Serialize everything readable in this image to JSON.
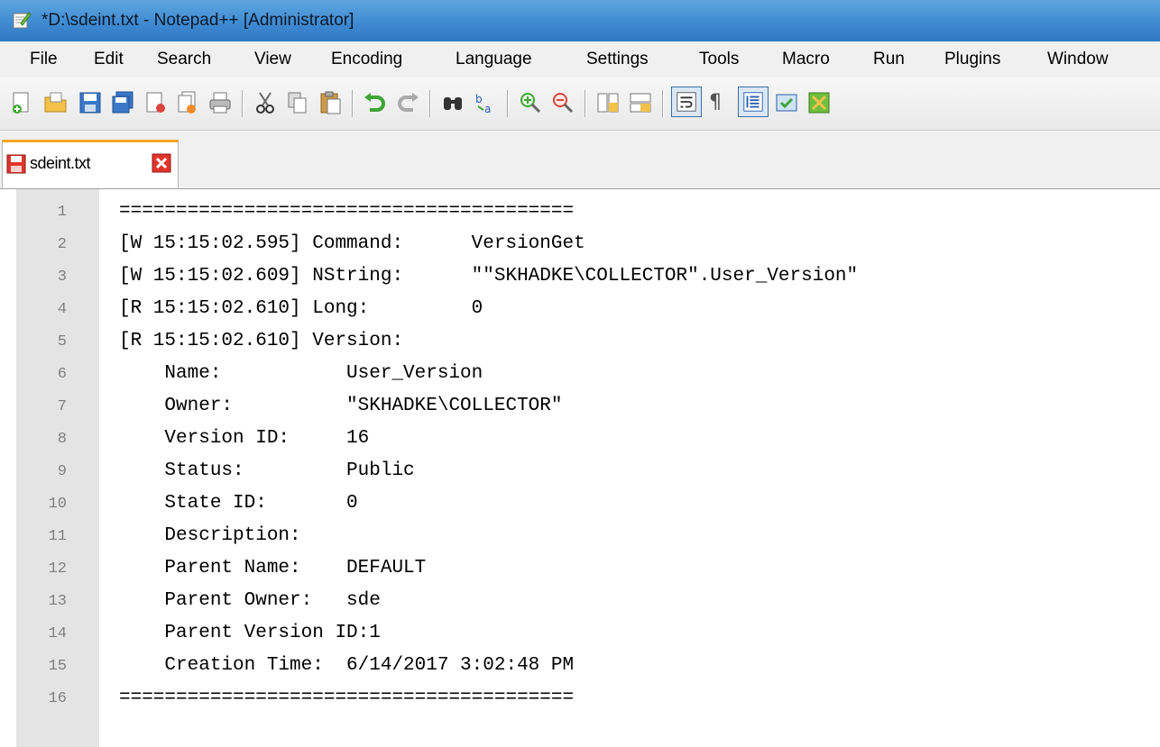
{
  "window": {
    "title": "*D:\\sdeint.txt - Notepad++ [Administrator]"
  },
  "menu": {
    "items": [
      {
        "label": "File"
      },
      {
        "label": "Edit"
      },
      {
        "label": "Search"
      },
      {
        "label": "View"
      },
      {
        "label": "Encoding"
      },
      {
        "label": "Language"
      },
      {
        "label": "Settings"
      },
      {
        "label": "Tools"
      },
      {
        "label": "Macro"
      },
      {
        "label": "Run"
      },
      {
        "label": "Plugins"
      },
      {
        "label": "Window"
      }
    ]
  },
  "toolbar": {
    "icons": [
      "new-file-icon",
      "open-file-icon",
      "save-icon",
      "save-all-icon",
      "close-icon",
      "close-all-icon",
      "print-icon",
      "cut-icon",
      "copy-icon",
      "paste-icon",
      "undo-icon",
      "redo-icon",
      "find-icon",
      "replace-icon",
      "zoom-in-icon",
      "zoom-out-icon",
      "sync-vertical-icon",
      "sync-horizontal-icon",
      "word-wrap-icon",
      "show-all-chars-icon",
      "indent-guide-icon",
      "user-language-icon",
      "doc-map-icon"
    ]
  },
  "tab": {
    "label": "sdeint.txt",
    "modified": true
  },
  "editor": {
    "lines": [
      {
        "num": "1",
        "text": "========================================"
      },
      {
        "num": "2",
        "text": "[W 15:15:02.595] Command:      VersionGet"
      },
      {
        "num": "3",
        "text": "[W 15:15:02.609] NString:      \"\"SKHADKE\\COLLECTOR\".User_Version\""
      },
      {
        "num": "4",
        "text": "[R 15:15:02.610] Long:         0"
      },
      {
        "num": "5",
        "text": "[R 15:15:02.610] Version:"
      },
      {
        "num": "6",
        "text": "    Name:           User_Version"
      },
      {
        "num": "7",
        "text": "    Owner:          \"SKHADKE\\COLLECTOR\""
      },
      {
        "num": "8",
        "text": "    Version ID:     16"
      },
      {
        "num": "9",
        "text": "    Status:         Public"
      },
      {
        "num": "10",
        "text": "    State ID:       0"
      },
      {
        "num": "11",
        "text": "    Description:"
      },
      {
        "num": "12",
        "text": "    Parent Name:    DEFAULT"
      },
      {
        "num": "13",
        "text": "    Parent Owner:   sde"
      },
      {
        "num": "14",
        "text": "    Parent Version ID:1"
      },
      {
        "num": "15",
        "text": "    Creation Time:  6/14/2017 3:02:48 PM"
      },
      {
        "num": "16",
        "text": "========================================"
      }
    ]
  },
  "colors": {
    "tab_accent": "#f5a623",
    "gutter": "#e4e4e4",
    "line_numbers": "#808080"
  }
}
